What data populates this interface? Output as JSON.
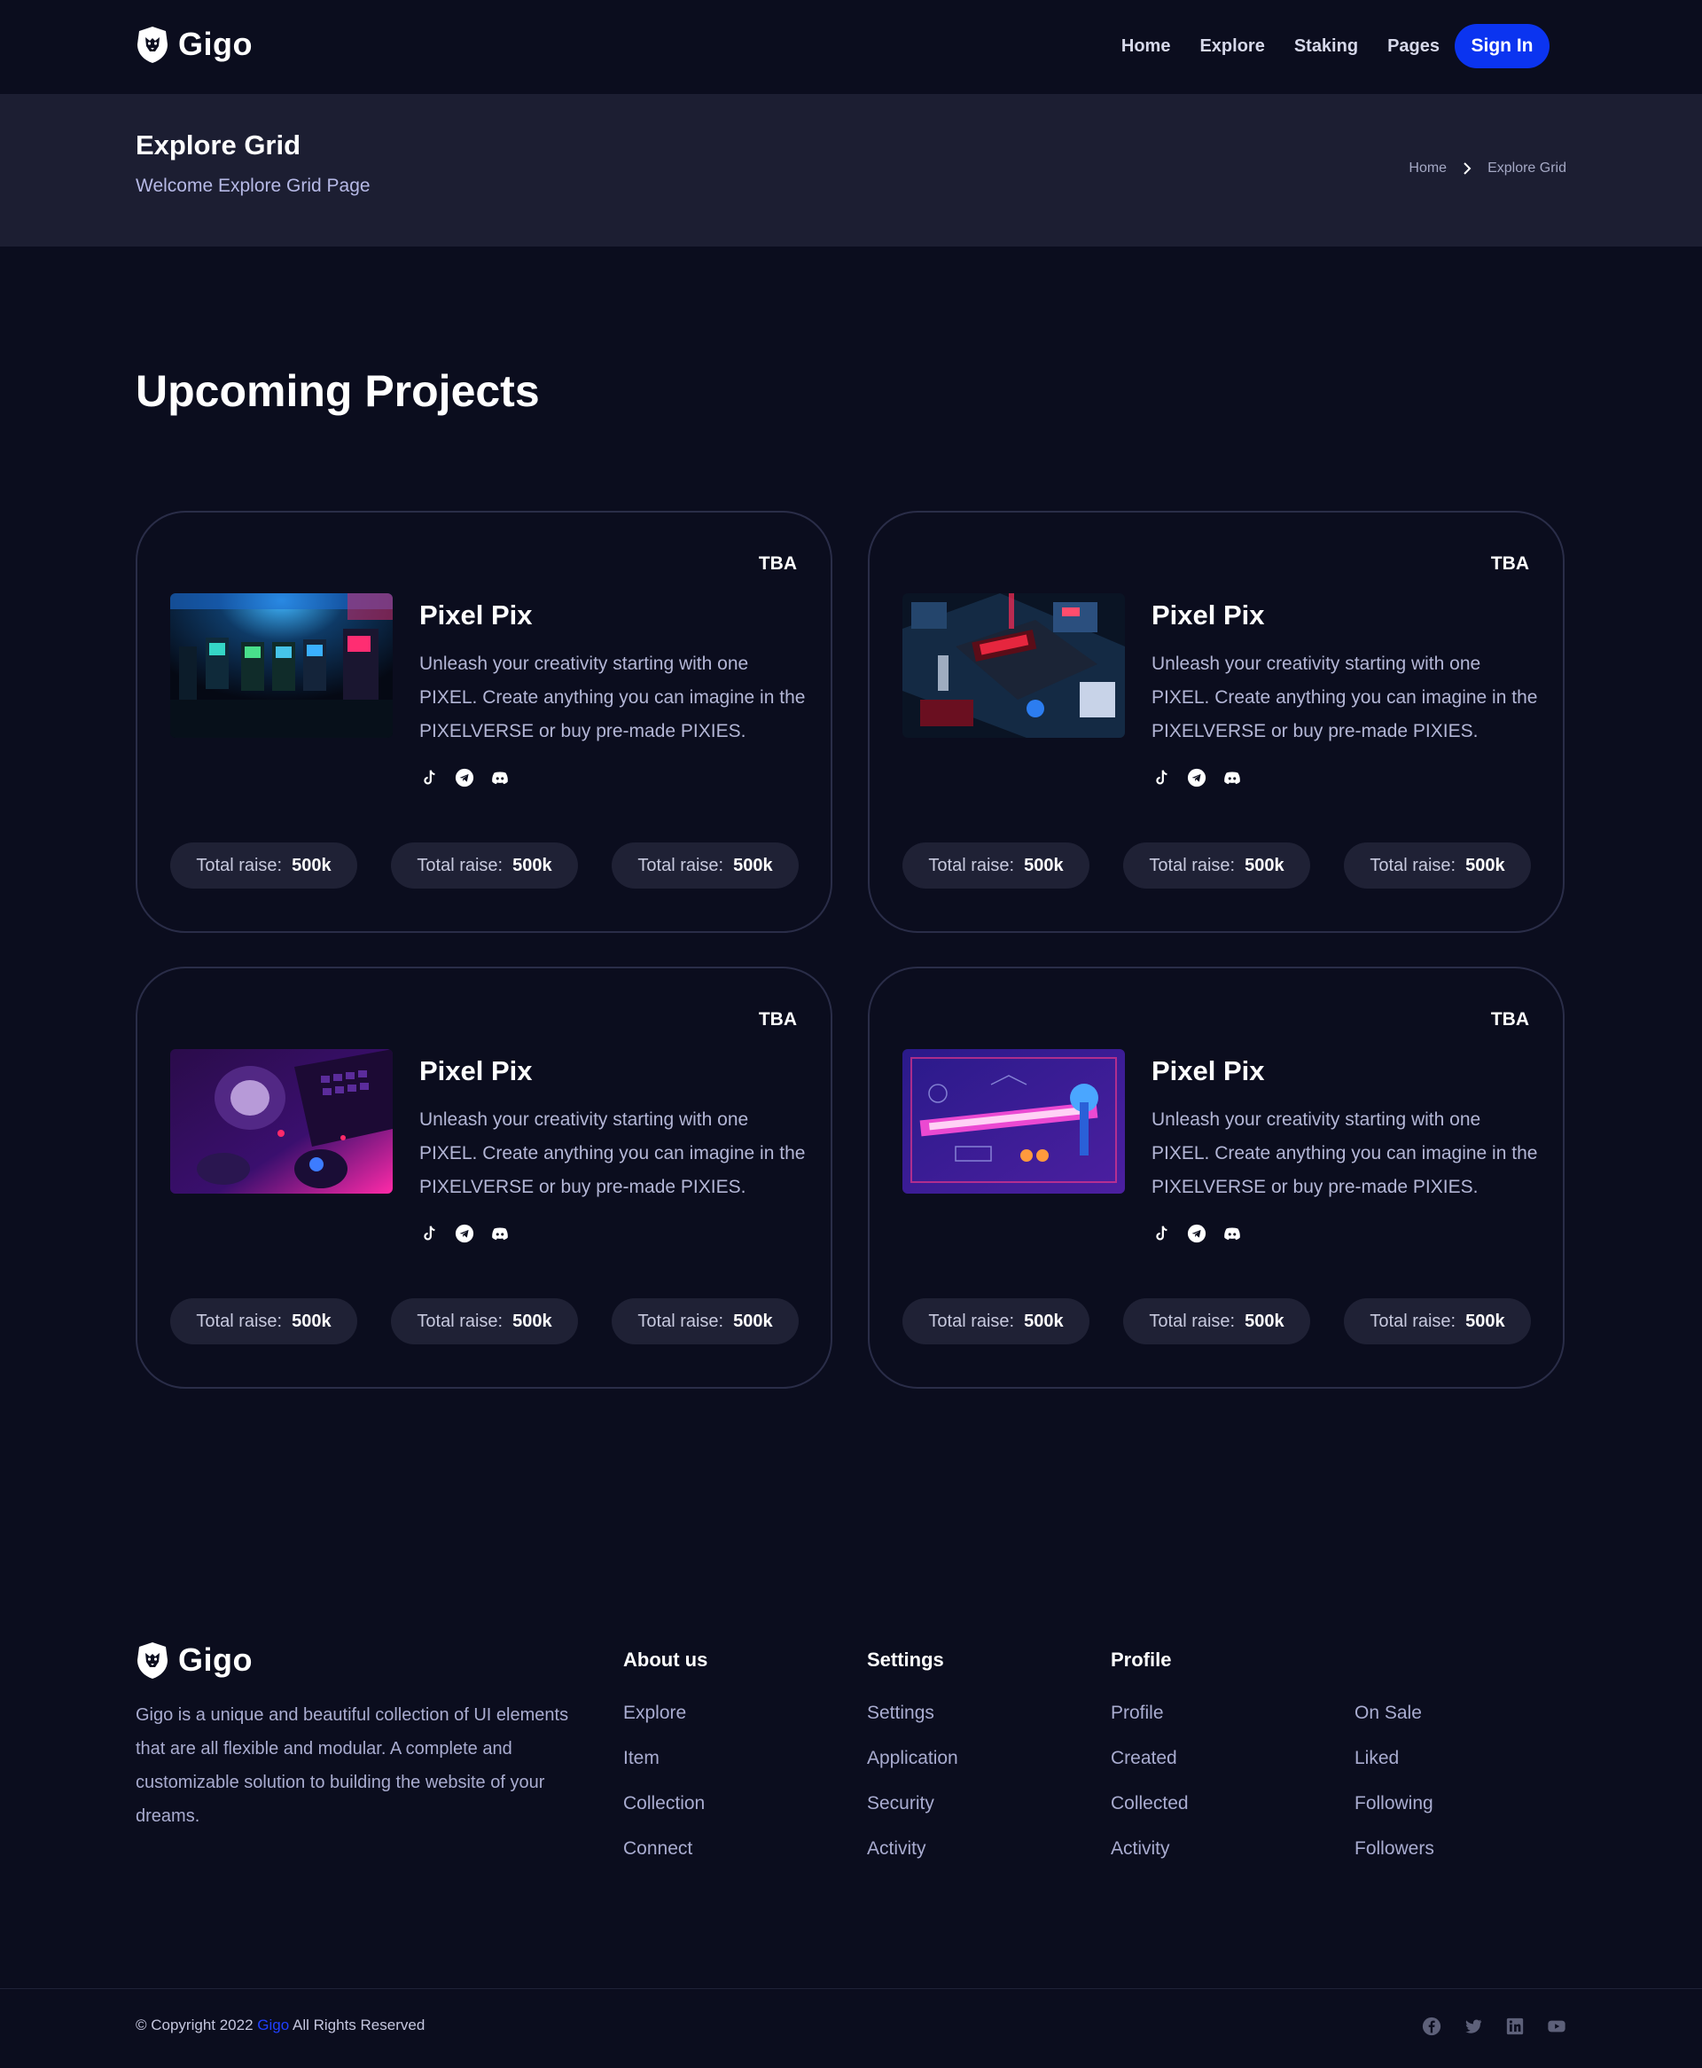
{
  "header": {
    "brand": "Gigo",
    "nav": [
      "Home",
      "Explore",
      "Staking",
      "Pages"
    ],
    "sign_in": "Sign In"
  },
  "banner": {
    "title": "Explore Grid",
    "subtitle": "Welcome Explore Grid Page",
    "breadcrumb": [
      "Home",
      "Explore Grid"
    ]
  },
  "section": {
    "title": "Upcoming Projects"
  },
  "cards": [
    {
      "badge": "TBA",
      "title": "Pixel Pix",
      "description": "Unleash your creativity starting with one PIXEL. Create anything you can imagine in the PIXELVERSE or buy pre-made PIXIES.",
      "image": "arcade-room-image",
      "raises": [
        {
          "label": "Total raise:",
          "value": "500k"
        },
        {
          "label": "Total raise:",
          "value": "500k"
        },
        {
          "label": "Total raise:",
          "value": "500k"
        }
      ]
    },
    {
      "badge": "TBA",
      "title": "Pixel Pix",
      "description": "Unleash your creativity starting with one PIXEL. Create anything you can imagine in the PIXELVERSE or buy pre-made PIXIES.",
      "image": "neon-circuit-image",
      "raises": [
        {
          "label": "Total raise:",
          "value": "500k"
        },
        {
          "label": "Total raise:",
          "value": "500k"
        },
        {
          "label": "Total raise:",
          "value": "500k"
        }
      ]
    },
    {
      "badge": "TBA",
      "title": "Pixel Pix",
      "description": "Unleash your creativity starting with one PIXEL. Create anything you can imagine in the PIXELVERSE or buy pre-made PIXIES.",
      "image": "gaming-desk-image",
      "raises": [
        {
          "label": "Total raise:",
          "value": "500k"
        },
        {
          "label": "Total raise:",
          "value": "500k"
        },
        {
          "label": "Total raise:",
          "value": "500k"
        }
      ]
    },
    {
      "badge": "TBA",
      "title": "Pixel Pix",
      "description": "Unleash your creativity starting with one PIXEL. Create anything you can imagine in the PIXELVERSE or buy pre-made PIXIES.",
      "image": "neon-controller-image",
      "raises": [
        {
          "label": "Total raise:",
          "value": "500k"
        },
        {
          "label": "Total raise:",
          "value": "500k"
        },
        {
          "label": "Total raise:",
          "value": "500k"
        }
      ]
    }
  ],
  "card_socials": [
    "tiktok-icon",
    "telegram-icon",
    "discord-icon"
  ],
  "footer": {
    "brand": "Gigo",
    "about": "Gigo is a unique and beautiful collection of UI elements that are all flexible and modular. A complete and customizable solution to building the website of your dreams.",
    "columns": [
      {
        "title": "About us",
        "links": [
          "Explore",
          "Item",
          "Collection",
          "Connect"
        ]
      },
      {
        "title": "Settings",
        "links": [
          "Settings",
          "Application",
          "Security",
          "Activity"
        ]
      },
      {
        "title": "Profile",
        "links": [
          "Profile",
          "Created",
          "Collected",
          "Activity"
        ]
      },
      {
        "title": "",
        "links": [
          "On Sale",
          "Liked",
          "Following",
          "Followers"
        ]
      }
    ],
    "copyright_prefix": "© Copyright 2022",
    "copyright_brand": "Gigo",
    "copyright_suffix": "All Rights Reserved",
    "socials": [
      "facebook-icon",
      "twitter-icon",
      "linkedin-icon",
      "youtube-icon"
    ]
  },
  "colors": {
    "background": "#0b0d1e",
    "banner": "#1c1e32",
    "accent": "#0b34f0",
    "pill": "#1f2135",
    "card_border": "#2a2d48"
  }
}
